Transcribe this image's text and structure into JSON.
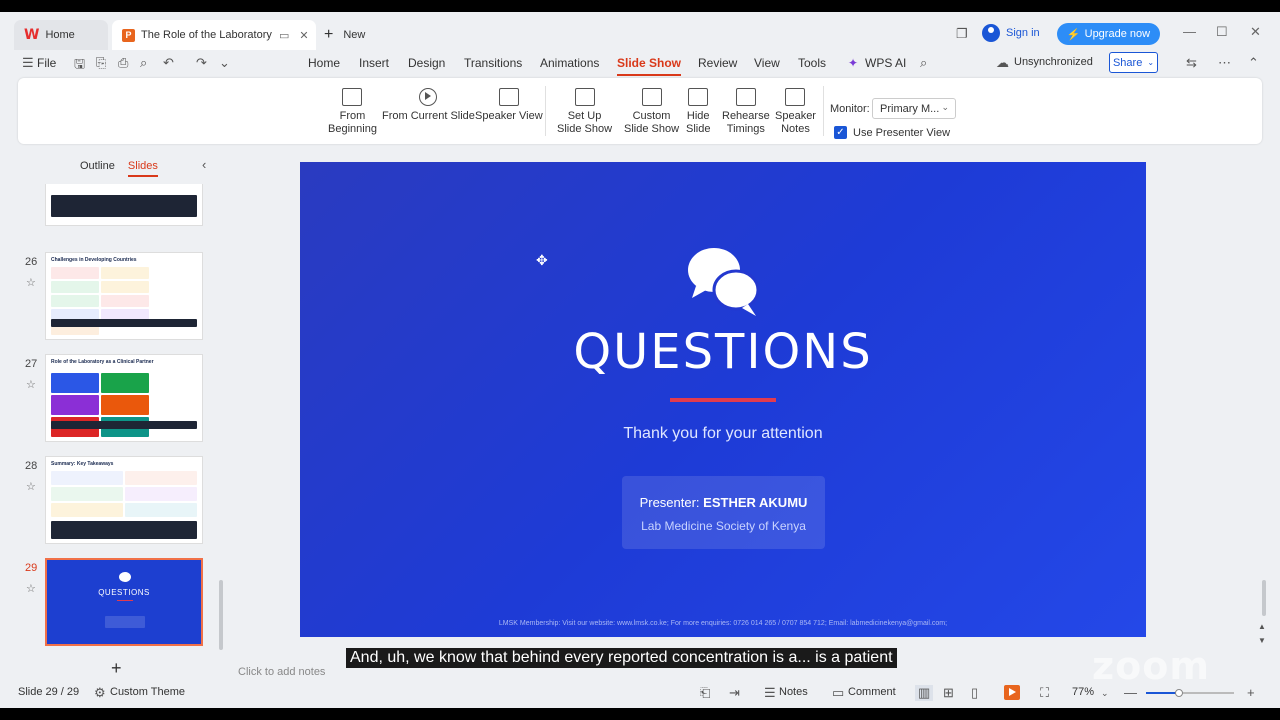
{
  "tabs": {
    "home_label": "Home",
    "doc_title": "The Role of the Laboratory in",
    "new_label": "New"
  },
  "account": {
    "signin": "Sign in",
    "upgrade": "Upgrade now"
  },
  "menu": {
    "file": "File",
    "items": [
      "Home",
      "Insert",
      "Design",
      "Transitions",
      "Animations",
      "Slide Show",
      "Review",
      "View",
      "Tools"
    ],
    "active": "Slide Show",
    "wps_ai": "WPS AI",
    "sync_status": "Unsynchronized",
    "share": "Share"
  },
  "ribbon": {
    "from_beginning": [
      "From",
      "Beginning"
    ],
    "from_current": "From Current Slide",
    "speaker_view": "Speaker View",
    "setup_show": [
      "Set Up",
      "Slide Show"
    ],
    "custom_show": [
      "Custom",
      "Slide Show"
    ],
    "hide_slide": [
      "Hide",
      "Slide"
    ],
    "rehearse": [
      "Rehearse",
      "Timings"
    ],
    "speaker_notes": [
      "Speaker",
      "Notes"
    ],
    "monitor_label": "Monitor:",
    "monitor_value": "Primary M...",
    "presenter_view": "Use Presenter View",
    "presenter_view_checked": true
  },
  "panel": {
    "outline_tab": "Outline",
    "slides_tab": "Slides",
    "slides": [
      {
        "num": "26",
        "title": "Challenges in Developing Countries"
      },
      {
        "num": "27",
        "title": "Role of the Laboratory as a Clinical Partner"
      },
      {
        "num": "28",
        "title": "Summary: Key Takeaways"
      },
      {
        "num": "29",
        "title": "QUESTIONS",
        "active": true
      }
    ]
  },
  "slide": {
    "title": "QUESTIONS",
    "subtitle": "Thank you for your attention",
    "presenter_prefix": "Presenter:",
    "presenter_name": "ESTHER AKUMU",
    "organization": "Lab Medicine Society of Kenya",
    "footer": "LMSK Membership: Visit our website: www.lmsk.co.ke; For more enquiries: 0726 014 265 / 0707 854 712; Email: labmedicinekenya@gmail.com;",
    "accent_color": "#e23b4e"
  },
  "notes_placeholder": "Click to add notes",
  "caption": "And, uh, we know that behind every reported concentration is a... is a patient",
  "watermark": "zoom",
  "status": {
    "slide_counter": "Slide 29 / 29",
    "theme": "Custom Theme",
    "notes": "Notes",
    "comment": "Comment",
    "zoom": "77%",
    "zoom_fraction": 0.77
  }
}
